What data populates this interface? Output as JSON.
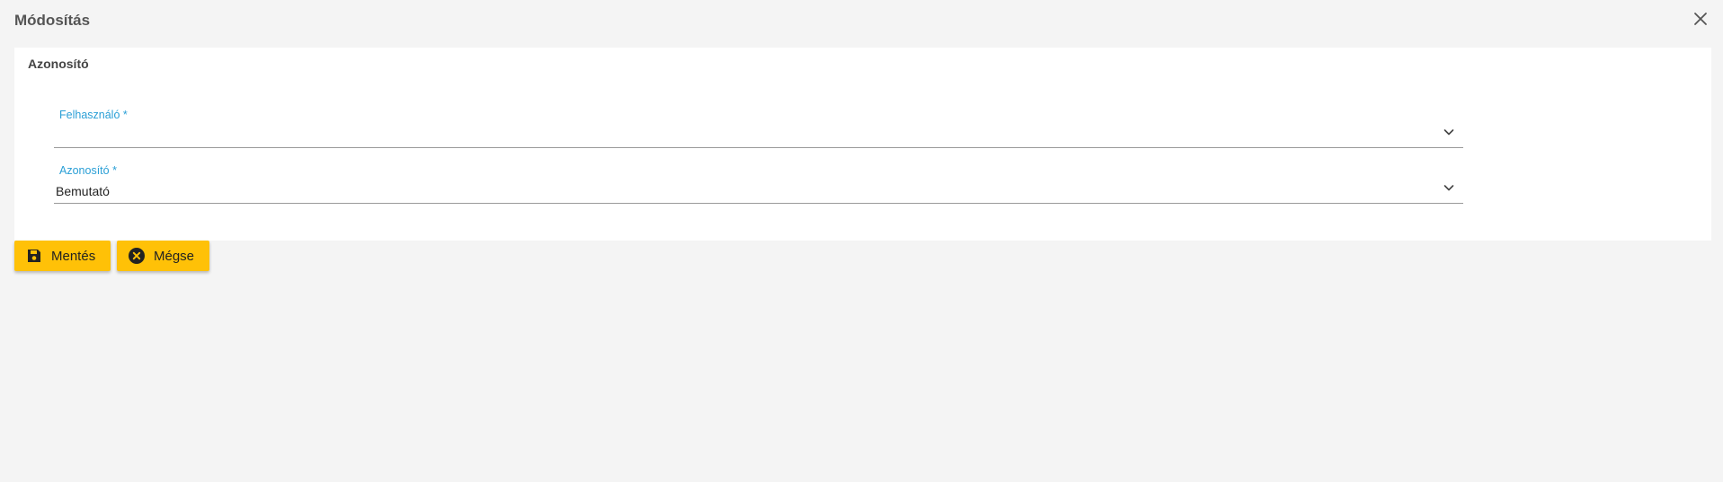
{
  "dialog": {
    "title": "Módosítás",
    "close_icon": "close-icon"
  },
  "form": {
    "section_title": "Azonosító",
    "fields": [
      {
        "label": "Felhasználó *",
        "value": "",
        "icon": "chevron-down-icon"
      },
      {
        "label": "Azonosító *",
        "value": "Bemutató",
        "icon": "chevron-down-icon"
      }
    ]
  },
  "actions": {
    "save_label": "Mentés",
    "save_icon": "floppy-disk-icon",
    "cancel_label": "Mégse",
    "cancel_icon": "cancel-circle-icon"
  },
  "colors": {
    "background": "#f4f4f4",
    "card": "#ffffff",
    "label_accent": "#2a9fd6",
    "button": "#ffc107"
  }
}
